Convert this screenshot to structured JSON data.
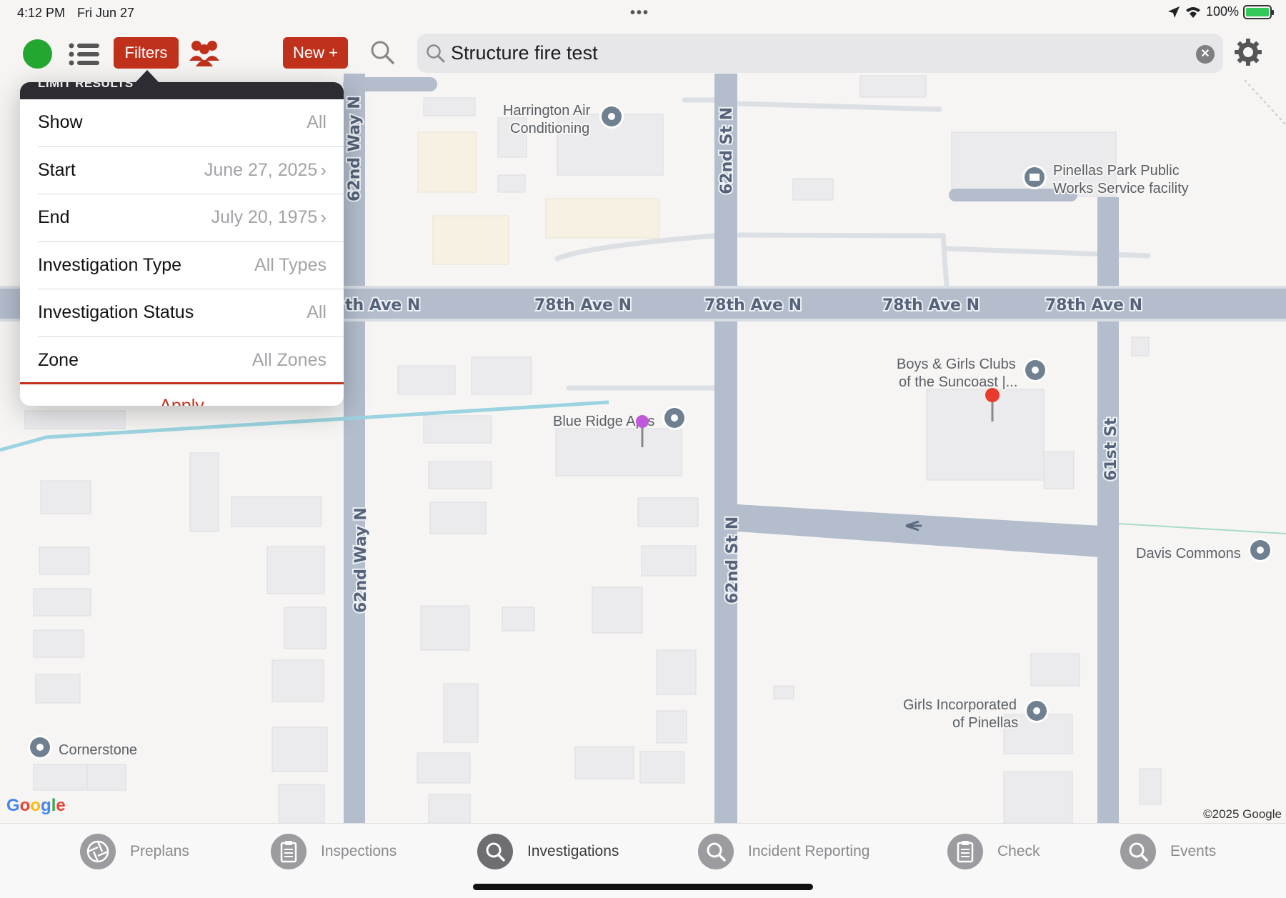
{
  "status_bar": {
    "time": "4:12 PM",
    "date": "Fri Jun 27",
    "battery": "100%"
  },
  "toolbar": {
    "filters_label": "Filters",
    "new_label": "New +",
    "search_value": "Structure fire test",
    "accent_color": "#c0311c",
    "status_color": "#23a731"
  },
  "filter_panel": {
    "header": "LIMIT RESULTS",
    "rows": [
      {
        "label": "Show",
        "value": "All",
        "chevron": false
      },
      {
        "label": "Start",
        "value": "June 27, 2025",
        "chevron": true
      },
      {
        "label": "End",
        "value": "July 20, 1975",
        "chevron": true
      },
      {
        "label": "Investigation Type",
        "value": "All Types",
        "chevron": false
      },
      {
        "label": "Investigation Status",
        "value": "All",
        "chevron": false
      },
      {
        "label": "Zone",
        "value": "All Zones",
        "chevron": false
      }
    ],
    "apply_label": "Apply"
  },
  "map": {
    "roads": {
      "ave_78th_partial": "th Ave N",
      "ave_78th": "78th Ave N",
      "way_62nd": "62nd Way N",
      "st_62nd": "62nd St N",
      "st_61st": "61st St"
    },
    "pois": {
      "harrington_1": "Harrington Air",
      "harrington_2": "Conditioning",
      "pinellas_1": "Pinellas Park Public",
      "pinellas_2": "Works Service facility",
      "boys_girls_1": "Boys & Girls Clubs",
      "boys_girls_2": "of the Suncoast |...",
      "blue_ridge": "Blue Ridge Apts",
      "davis": "Davis Commons",
      "girls_inc_1": "Girls Incorporated",
      "girls_inc_2": "of Pinellas",
      "cornerstone": "Cornerstone"
    },
    "google_logo": "Google",
    "copyright": "©2025 Google"
  },
  "tabs": [
    {
      "label": "Preplans",
      "icon": "aperture-icon",
      "active": false
    },
    {
      "label": "Inspections",
      "icon": "clipboard-icon",
      "active": false
    },
    {
      "label": "Investigations",
      "icon": "magnifier-icon",
      "active": true
    },
    {
      "label": "Incident Reporting",
      "icon": "magnifier-icon",
      "active": false
    },
    {
      "label": "Check",
      "icon": "clipboard-icon",
      "active": false
    },
    {
      "label": "Events",
      "icon": "magnifier-icon",
      "active": false
    }
  ]
}
